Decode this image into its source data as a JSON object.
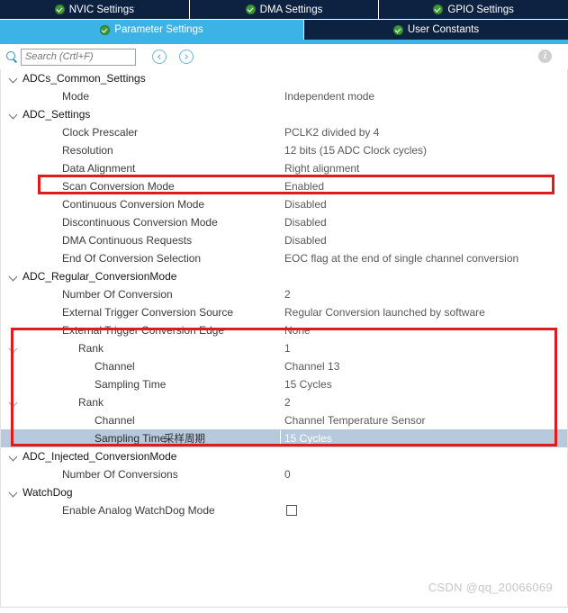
{
  "tabs_top": [
    {
      "label": "NVIC Settings",
      "icon": "check-circle-icon",
      "active": false
    },
    {
      "label": "DMA Settings",
      "icon": "check-circle-icon",
      "active": false
    },
    {
      "label": "GPIO Settings",
      "icon": "check-circle-icon",
      "active": false
    }
  ],
  "tabs_sub": [
    {
      "label": "Parameter Settings",
      "icon": "check-circle-icon",
      "active": true
    },
    {
      "label": "User Constants",
      "icon": "check-circle-icon",
      "active": false
    }
  ],
  "toolbar": {
    "search_placeholder": "Search (Crtl+F)",
    "search_value": "",
    "back_label": "",
    "forward_label": "",
    "info_label": "i"
  },
  "tree": [
    {
      "type": "group",
      "label": "ADCs_Common_Settings",
      "value": ""
    },
    {
      "type": "prop",
      "label": "Mode",
      "value": "Independent mode"
    },
    {
      "type": "group",
      "label": "ADC_Settings",
      "value": ""
    },
    {
      "type": "prop",
      "label": "Clock Prescaler",
      "value": "PCLK2 divided by 4"
    },
    {
      "type": "prop",
      "label": "Resolution",
      "value": "12 bits (15 ADC Clock cycles)"
    },
    {
      "type": "prop",
      "label": "Data Alignment",
      "value": "Right alignment"
    },
    {
      "type": "prop",
      "label": "Scan Conversion Mode",
      "value": "Enabled"
    },
    {
      "type": "prop",
      "label": "Continuous Conversion Mode",
      "value": "Disabled"
    },
    {
      "type": "prop",
      "label": "Discontinuous Conversion Mode",
      "value": "Disabled"
    },
    {
      "type": "prop",
      "label": "DMA Continuous Requests",
      "value": "Disabled"
    },
    {
      "type": "prop",
      "label": "End Of Conversion Selection",
      "value": "EOC flag at the end of single channel conversion"
    },
    {
      "type": "group",
      "label": "ADC_Regular_ConversionMode",
      "value": ""
    },
    {
      "type": "prop",
      "label": "Number Of Conversion",
      "value": "2"
    },
    {
      "type": "prop",
      "label": "External Trigger Conversion Source",
      "value": "Regular Conversion launched by software"
    },
    {
      "type": "prop",
      "label": "External Trigger Conversion Edge",
      "value": "None"
    },
    {
      "type": "rank",
      "label": "Rank",
      "value": "1"
    },
    {
      "type": "sub",
      "label": "Channel",
      "value": "Channel 13"
    },
    {
      "type": "sub",
      "label": "Sampling Time",
      "value": "15 Cycles"
    },
    {
      "type": "rank",
      "label": "Rank",
      "value": "2"
    },
    {
      "type": "sub",
      "label": "Channel",
      "value": "Channel Temperature Sensor"
    },
    {
      "type": "sub_selected",
      "label": "Sampling Time",
      "note": "采样周期",
      "value": "15 Cycles"
    },
    {
      "type": "group",
      "label": "ADC_Injected_ConversionMode",
      "value": ""
    },
    {
      "type": "prop",
      "label": "Number Of Conversions",
      "value": "0"
    },
    {
      "type": "group",
      "label": "WatchDog",
      "value": ""
    },
    {
      "type": "checkbox",
      "label": "Enable Analog WatchDog Mode",
      "value": "",
      "checked": false
    }
  ],
  "annotations": {
    "highlight_color": "#e01b1b",
    "note_color": "#e8262a",
    "box_1_label": "scan-conversion-mode-highlight",
    "box_2_label": "rank-list-highlight"
  },
  "watermark": "CSDN @qq_20066069"
}
